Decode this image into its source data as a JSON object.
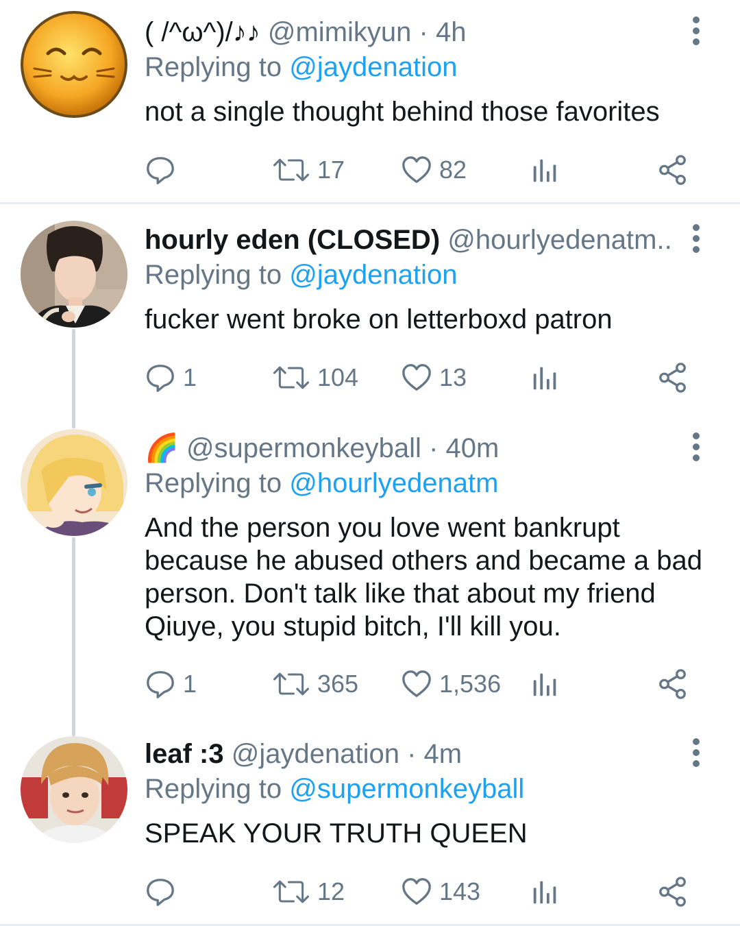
{
  "tweets": [
    {
      "display_name": "( /^ω^)/♪♪",
      "handle": "@mimikyun",
      "time": "· 4h",
      "replying_label": "Replying to",
      "replying_to": "@jaydenation",
      "text": "not a single thought behind those favorites",
      "replies": "",
      "retweets": "17",
      "likes": "82"
    },
    {
      "display_name": "hourly eden (CLOSED)",
      "handle": "@hourlyedenatm...",
      "time": "",
      "replying_label": "Replying to",
      "replying_to": "@jaydenation",
      "text": "fucker went broke on letterboxd patron",
      "replies": "1",
      "retweets": "104",
      "likes": "13"
    },
    {
      "display_name": "🌈",
      "handle": "@supermonkeyball",
      "time": "· 40m",
      "replying_label": "Replying to",
      "replying_to": "@hourlyedenatm",
      "text": "And the person you love went bankrupt because he abused others and became a bad person. Don't talk like that about my friend Qiuye, you stupid bitch, I'll kill you.",
      "replies": "1",
      "retweets": "365",
      "likes": "1,536"
    },
    {
      "display_name": "leaf :3",
      "handle": "@jaydenation",
      "time": "· 4m",
      "replying_label": "Replying to",
      "replying_to": "@supermonkeyball",
      "text": "SPEAK YOUR TRUTH QUEEN",
      "replies": "",
      "retweets": "12",
      "likes": "143"
    }
  ],
  "colors": {
    "mention": "#1da1f2",
    "secondary": "#657786",
    "text": "#14171a",
    "divider": "#e6ecf0",
    "thread_line": "#ccd6dd"
  },
  "icons": [
    "reply-icon",
    "retweet-icon",
    "like-icon",
    "analytics-icon",
    "share-icon",
    "more-icon"
  ]
}
